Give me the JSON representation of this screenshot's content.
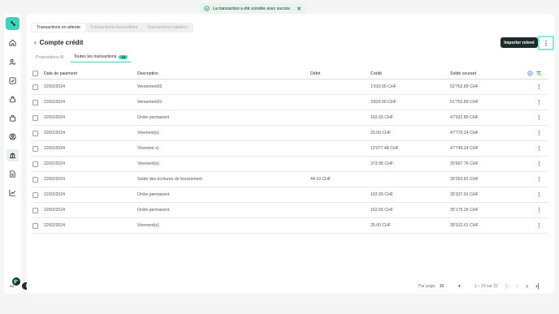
{
  "toast": {
    "message": "La transaction a été scindée avec succès"
  },
  "top_tabs": [
    "Transactions en attente",
    "Transactions réconciliées",
    "Transactions rejetées"
  ],
  "page": {
    "title": "Compte crédit",
    "import_label": "Importer relevé",
    "more_label": "⋮"
  },
  "sub_tabs": [
    {
      "label": "Propositions AI"
    },
    {
      "label": "Toutes les transactions",
      "count": "22"
    }
  ],
  "table": {
    "headers": {
      "date": "Date de paiement",
      "description": "Description",
      "debit": "Débit",
      "credit": "Crédit",
      "solde": "Solde courant"
    },
    "rows": [
      {
        "date": "22/02/2024",
        "description": "Versement02",
        "debit": "",
        "credit": "1'010.00 CHF",
        "solde": "52'762.89 CHF"
      },
      {
        "date": "22/02/2024",
        "description": "Versement01",
        "debit": "",
        "credit": "3'820.00 CHF",
        "solde": "51'752.89 CHF"
      },
      {
        "date": "22/02/2024",
        "description": "Ordre permanent",
        "debit": "",
        "credit": "162.65 CHF",
        "solde": "47'932.89 CHF"
      },
      {
        "date": "22/02/2024",
        "description": "Virement(s)",
        "debit": "",
        "credit": "25.00 CHF",
        "solde": "47'770.24 CHF"
      },
      {
        "date": "22/02/2024",
        "description": "Virement s)",
        "debit": "",
        "credit": "12'077.48 CHF",
        "solde": "47'745.24 CHF"
      },
      {
        "date": "22/02/2024",
        "description": "Virement(s)",
        "debit": "",
        "credit": "373.95 CHF",
        "solde": "35'667.76 CHF"
      },
      {
        "date": "22/02/2024",
        "description": "Solde des écritures de bouclement",
        "debit": "44.10 CHF",
        "credit": "",
        "solde": "35'293.81 CHF"
      },
      {
        "date": "22/02/2024",
        "description": "Ordre permanent",
        "debit": "",
        "credit": "162.65 CHF",
        "solde": "35'337.91 CHF"
      },
      {
        "date": "22/02/2024",
        "description": "Ordre permanent",
        "debit": "",
        "credit": "162.65 CHF",
        "solde": "35'175.26 CHF"
      },
      {
        "date": "22/02/2024",
        "description": "Virement(s)",
        "debit": "",
        "credit": "25.00 CHF",
        "solde": "35'012.61 CHF"
      }
    ]
  },
  "pagination": {
    "per_page_label": "Par page:",
    "per_page_value": "10",
    "range": "1 – 10 sur 22"
  },
  "sidebar": {
    "avatar_initials": "BA",
    "badge": "18"
  },
  "colors": {
    "accent": "#3ed3b8",
    "dark": "#1f2a2a",
    "toast_bg": "#e8f5ec"
  },
  "icons": [
    "home-icon",
    "people-icon",
    "checklist-icon",
    "money-bag-icon",
    "shopping-bag-icon",
    "account-icon",
    "bank-icon",
    "document-icon",
    "chart-icon",
    "settings-icon",
    "filter-icon",
    "success-icon",
    "close-icon",
    "back-icon"
  ]
}
